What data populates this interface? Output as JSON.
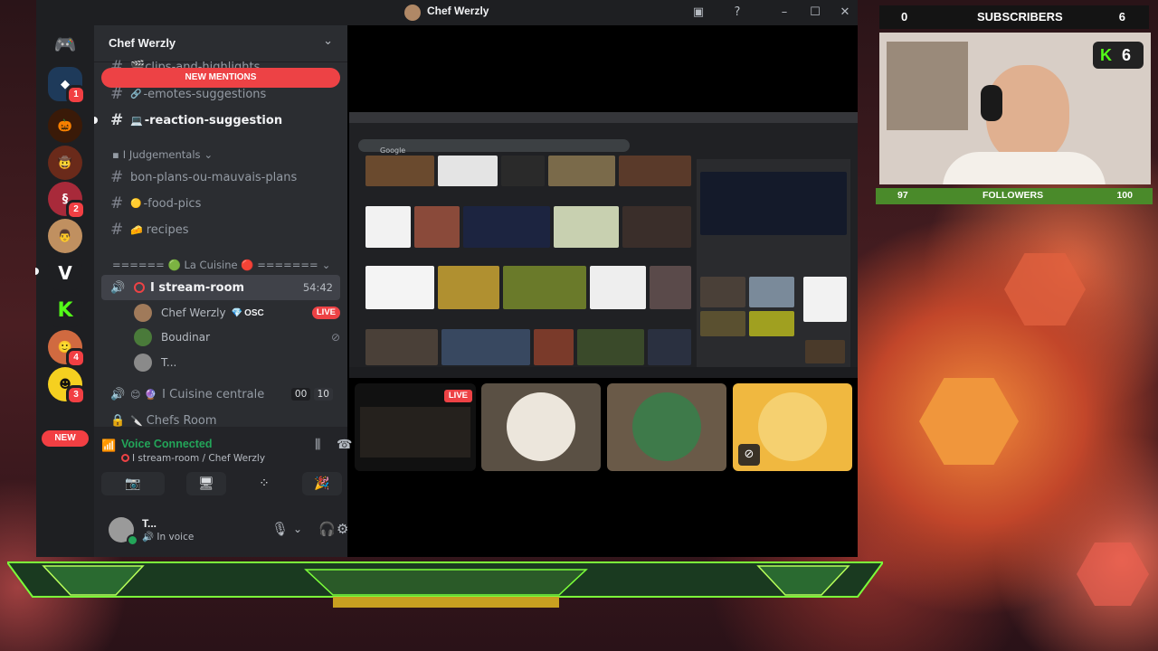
{
  "window": {
    "title": "Chef Werzly"
  },
  "rail": {
    "badges": [
      "1",
      "2",
      "4",
      "3"
    ],
    "new_label": "NEW"
  },
  "sidebar": {
    "server_name": "Chef Werzly",
    "new_mentions": "NEW MENTIONS",
    "channels_top": [
      {
        "emoji": "🎬",
        "name": "clips-and-highlights"
      },
      {
        "emoji": "🔗",
        "name": "-emotes-suggestions"
      },
      {
        "emoji": "💻",
        "name": "-reaction-suggestion"
      }
    ],
    "category_judgements": "I Judgementals",
    "channels_mid": [
      {
        "emoji": "",
        "name": "bon-plans-ou-mauvais-plans"
      },
      {
        "emoji": "🟡",
        "name": "-food-pics"
      },
      {
        "emoji": "🧀",
        "name": "recipes"
      }
    ],
    "category_cuisine": "====== 🟢 La Cuisine 🔴 =======",
    "stream_room": {
      "name": "I stream-room",
      "timer": "54:42"
    },
    "voice_users": [
      {
        "name": "Chef Werzly",
        "tag": "OSC",
        "live": "LIVE"
      },
      {
        "name": "Boudinar"
      },
      {
        "name": "T..."
      }
    ],
    "cuisine_centrale": {
      "name": "I Cuisine centrale",
      "count_a": "00",
      "count_b": "10"
    },
    "chefs_room": "Chefs Room"
  },
  "voice_panel": {
    "status": "Voice Connected",
    "location": "I stream-room / Chef Werzly"
  },
  "user_panel": {
    "name": "T...",
    "status": "In voice"
  },
  "stream": {
    "live_label": "LIVE",
    "search_brand": "Google"
  },
  "overlay": {
    "subscribers_label": "SUBSCRIBERS",
    "subscribers_left": "0",
    "subscribers_right": "6",
    "kick_count": "6",
    "followers_label": "FOLLOWERS",
    "followers_left": "97",
    "followers_right": "100"
  },
  "colors": {
    "discord_green": "#23a559",
    "discord_red": "#ed4245",
    "overlay_green": "#7cff3a"
  }
}
